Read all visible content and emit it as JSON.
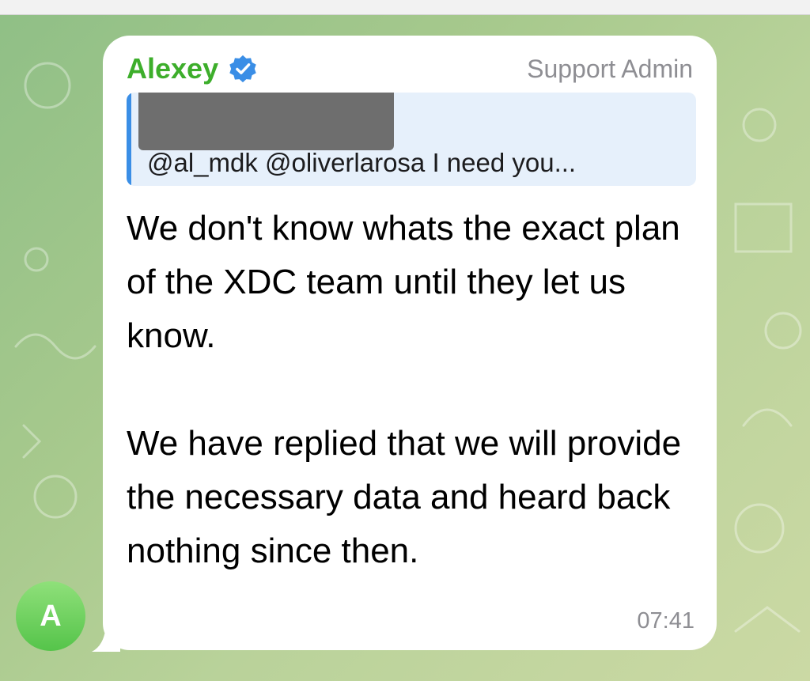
{
  "message": {
    "sender_name": "Alexey",
    "sender_role": "Support Admin",
    "reply_preview_text": "@al_mdk @oliverlarosa I need you...",
    "paragraphs": [
      "We don't know whats the exact plan of the XDC team until they let us know.",
      "We have replied that we will provide the necessary data and heard back nothing since then."
    ],
    "time": "07:41",
    "avatar_initial": "A"
  },
  "colors": {
    "sender_name": "#3dae2b",
    "verified_badge": "#3a8ee6",
    "reply_bar": "#3a8ee6",
    "avatar": "#55c44a"
  },
  "icons": {
    "verified": "verified-badge-icon"
  }
}
